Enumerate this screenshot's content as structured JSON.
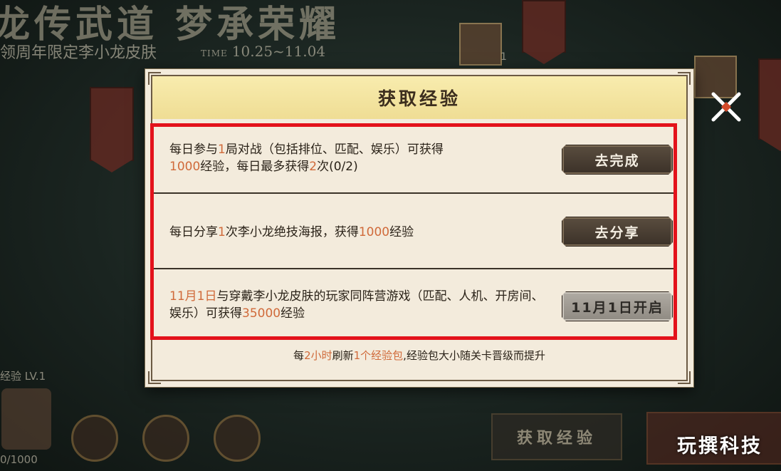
{
  "background": {
    "title": "龙传武道 梦承荣耀",
    "subtitle": "领周年限定李小龙皮肤",
    "time_prefix": "TIME",
    "time_range": "10.25~11.04",
    "hero_count": "1",
    "level_label": "经验 LV.1",
    "exp_progress": "0/1000",
    "bottom_button": "获取经验"
  },
  "dialog": {
    "title": "获取经验",
    "tasks": [
      {
        "desc_parts": [
          "每日参与",
          "1",
          "局对战（包括排位、匹配、娱乐）可获得",
          "1000",
          "经验，每日最多获得",
          "2",
          "次(0/2)"
        ],
        "button": "去完成",
        "button_enabled": true
      },
      {
        "desc_parts": [
          "每日分享",
          "1",
          "次李小龙绝技海报，获得",
          "1000",
          "经验"
        ],
        "button": "去分享",
        "button_enabled": true
      },
      {
        "desc_parts": [
          "11月1日",
          "与穿戴李小龙皮肤的玩家同阵营游戏（匹配、人机、开房间、娱乐）可获得",
          "35000",
          "经验"
        ],
        "button": "11月1日开启",
        "button_enabled": false
      }
    ],
    "footer_parts": [
      "每",
      "2小时",
      "刷新",
      "1个经验包",
      ",经验包大小随关卡晋级而提升"
    ]
  },
  "watermark": "玩撰科技",
  "colors": {
    "highlight": "#d06a3a",
    "frame_red": "#e3121b",
    "header": "#f4e29f"
  }
}
